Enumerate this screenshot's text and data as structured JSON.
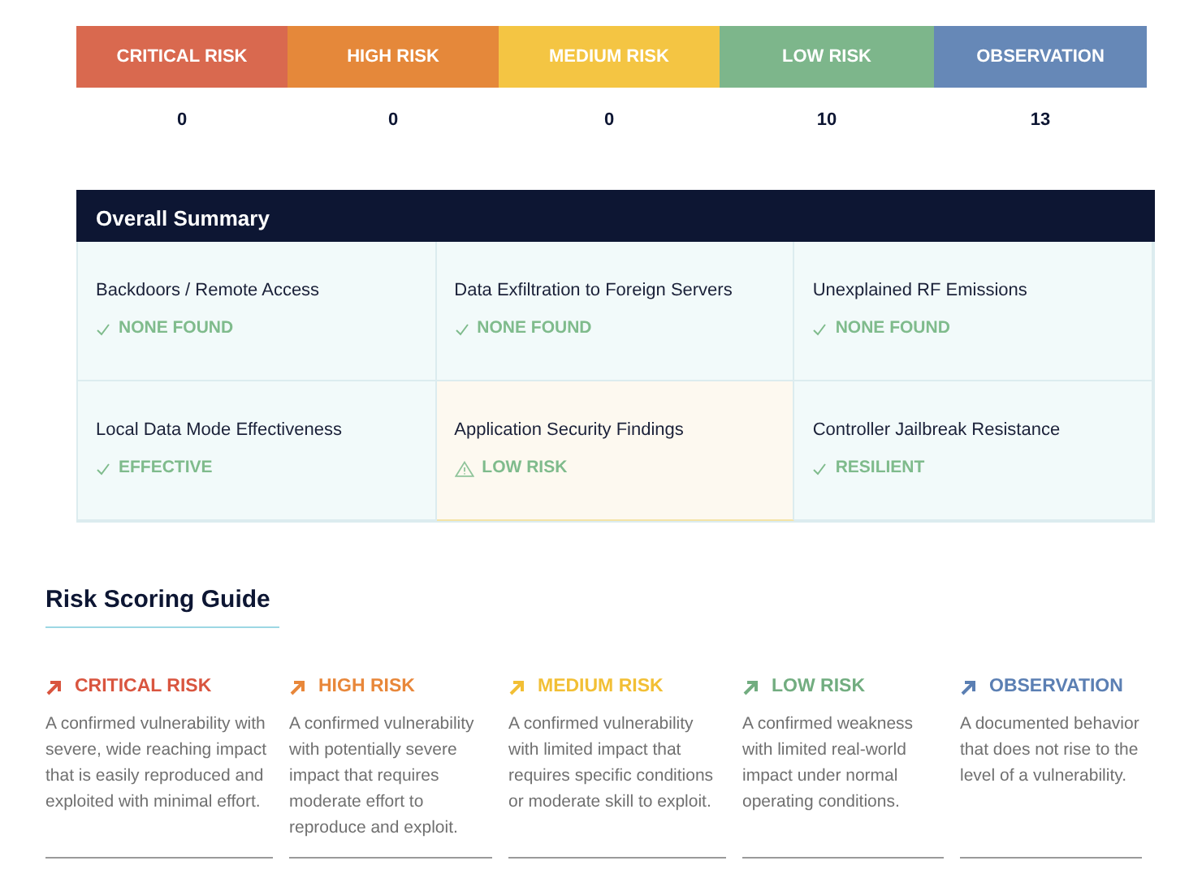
{
  "risk_counts": [
    {
      "label": "CRITICAL RISK",
      "count": "0",
      "color": "#d9694f"
    },
    {
      "label": "HIGH RISK",
      "count": "0",
      "color": "#e5883a"
    },
    {
      "label": "MEDIUM RISK",
      "count": "0",
      "color": "#f4c543"
    },
    {
      "label": "LOW RISK",
      "count": "10",
      "color": "#7db68b"
    },
    {
      "label": "OBSERVATION",
      "count": "13",
      "color": "#6688b7"
    }
  ],
  "overall_summary": {
    "title": "Overall Summary",
    "items": [
      {
        "label": "Backdoors / Remote Access",
        "status": "NONE FOUND",
        "kind": "ok"
      },
      {
        "label": "Data Exfiltration to Foreign Servers",
        "status": "NONE FOUND",
        "kind": "ok"
      },
      {
        "label": "Unexplained RF Emissions",
        "status": "NONE FOUND",
        "kind": "ok"
      },
      {
        "label": "Local Data Mode Effectiveness",
        "status": "EFFECTIVE",
        "kind": "ok"
      },
      {
        "label": "Application Security Findings",
        "status": "LOW RISK",
        "kind": "warning"
      },
      {
        "label": "Controller Jailbreak Resistance",
        "status": "RESILIENT",
        "kind": "ok"
      }
    ]
  },
  "risk_scoring_guide": {
    "title": "Risk Scoring Guide",
    "levels": [
      {
        "label": "CRITICAL RISK",
        "color": "#d9553f",
        "description": "A confirmed vulnerability with severe, wide reaching impact that is easily reproduced and exploited with minimal effort."
      },
      {
        "label": "HIGH RISK",
        "color": "#e8873a",
        "description": "A confirmed vulnerability with potentially severe impact that requires moderate effort to reproduce and exploit."
      },
      {
        "label": "MEDIUM RISK",
        "color": "#f2bf35",
        "description": "A confirmed vulnerability with limited impact that requires specific conditions or moderate skill to exploit."
      },
      {
        "label": "LOW RISK",
        "color": "#72ad80",
        "description": "A confirmed weakness with limited real-world impact under normal operating conditions."
      },
      {
        "label": "OBSERVATION",
        "color": "#5b7fb3",
        "description": "A documented behavior that does not rise to the level of a vulnerability."
      }
    ]
  }
}
